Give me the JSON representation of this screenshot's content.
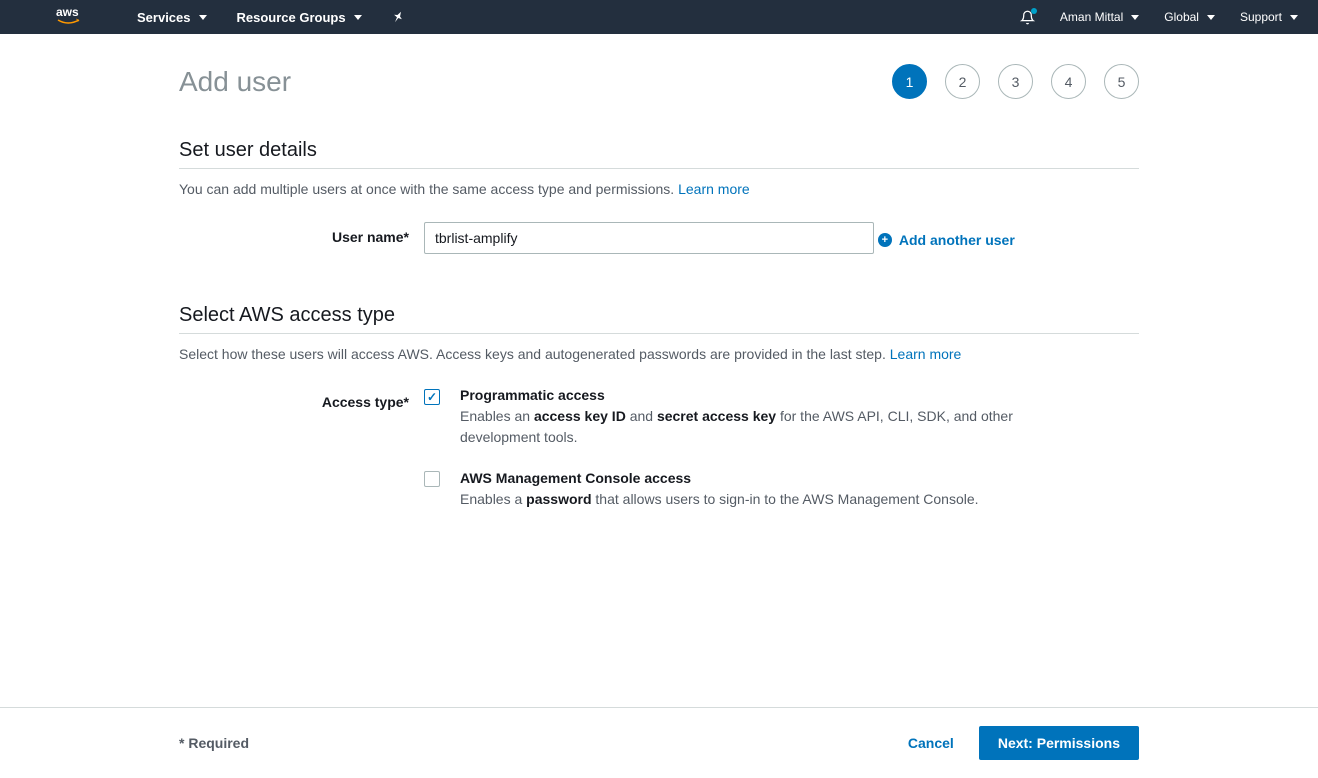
{
  "nav": {
    "services": "Services",
    "resource_groups": "Resource Groups",
    "user": "Aman Mittal",
    "region": "Global",
    "support": "Support"
  },
  "page": {
    "title": "Add user"
  },
  "steps": [
    "1",
    "2",
    "3",
    "4",
    "5"
  ],
  "active_step": 1,
  "section1": {
    "title": "Set user details",
    "desc": "You can add multiple users at once with the same access type and permissions. ",
    "learn_more": "Learn more",
    "user_name_label": "User name*",
    "user_name_value": "tbrlist-amplify",
    "add_another": "Add another user"
  },
  "section2": {
    "title": "Select AWS access type",
    "desc": "Select how these users will access AWS. Access keys and autogenerated passwords are provided in the last step. ",
    "learn_more": "Learn more",
    "access_type_label": "Access type*",
    "programmatic": {
      "title": "Programmatic access",
      "desc_pre": "Enables an ",
      "desc_b1": "access key ID",
      "desc_mid": " and ",
      "desc_b2": "secret access key",
      "desc_post": " for the AWS API, CLI, SDK, and other development tools.",
      "checked": true
    },
    "console": {
      "title": "AWS Management Console access",
      "desc_pre": "Enables a ",
      "desc_b1": "password",
      "desc_post": " that allows users to sign-in to the AWS Management Console.",
      "checked": false
    }
  },
  "footer": {
    "required": "* Required",
    "cancel": "Cancel",
    "next": "Next: Permissions"
  }
}
